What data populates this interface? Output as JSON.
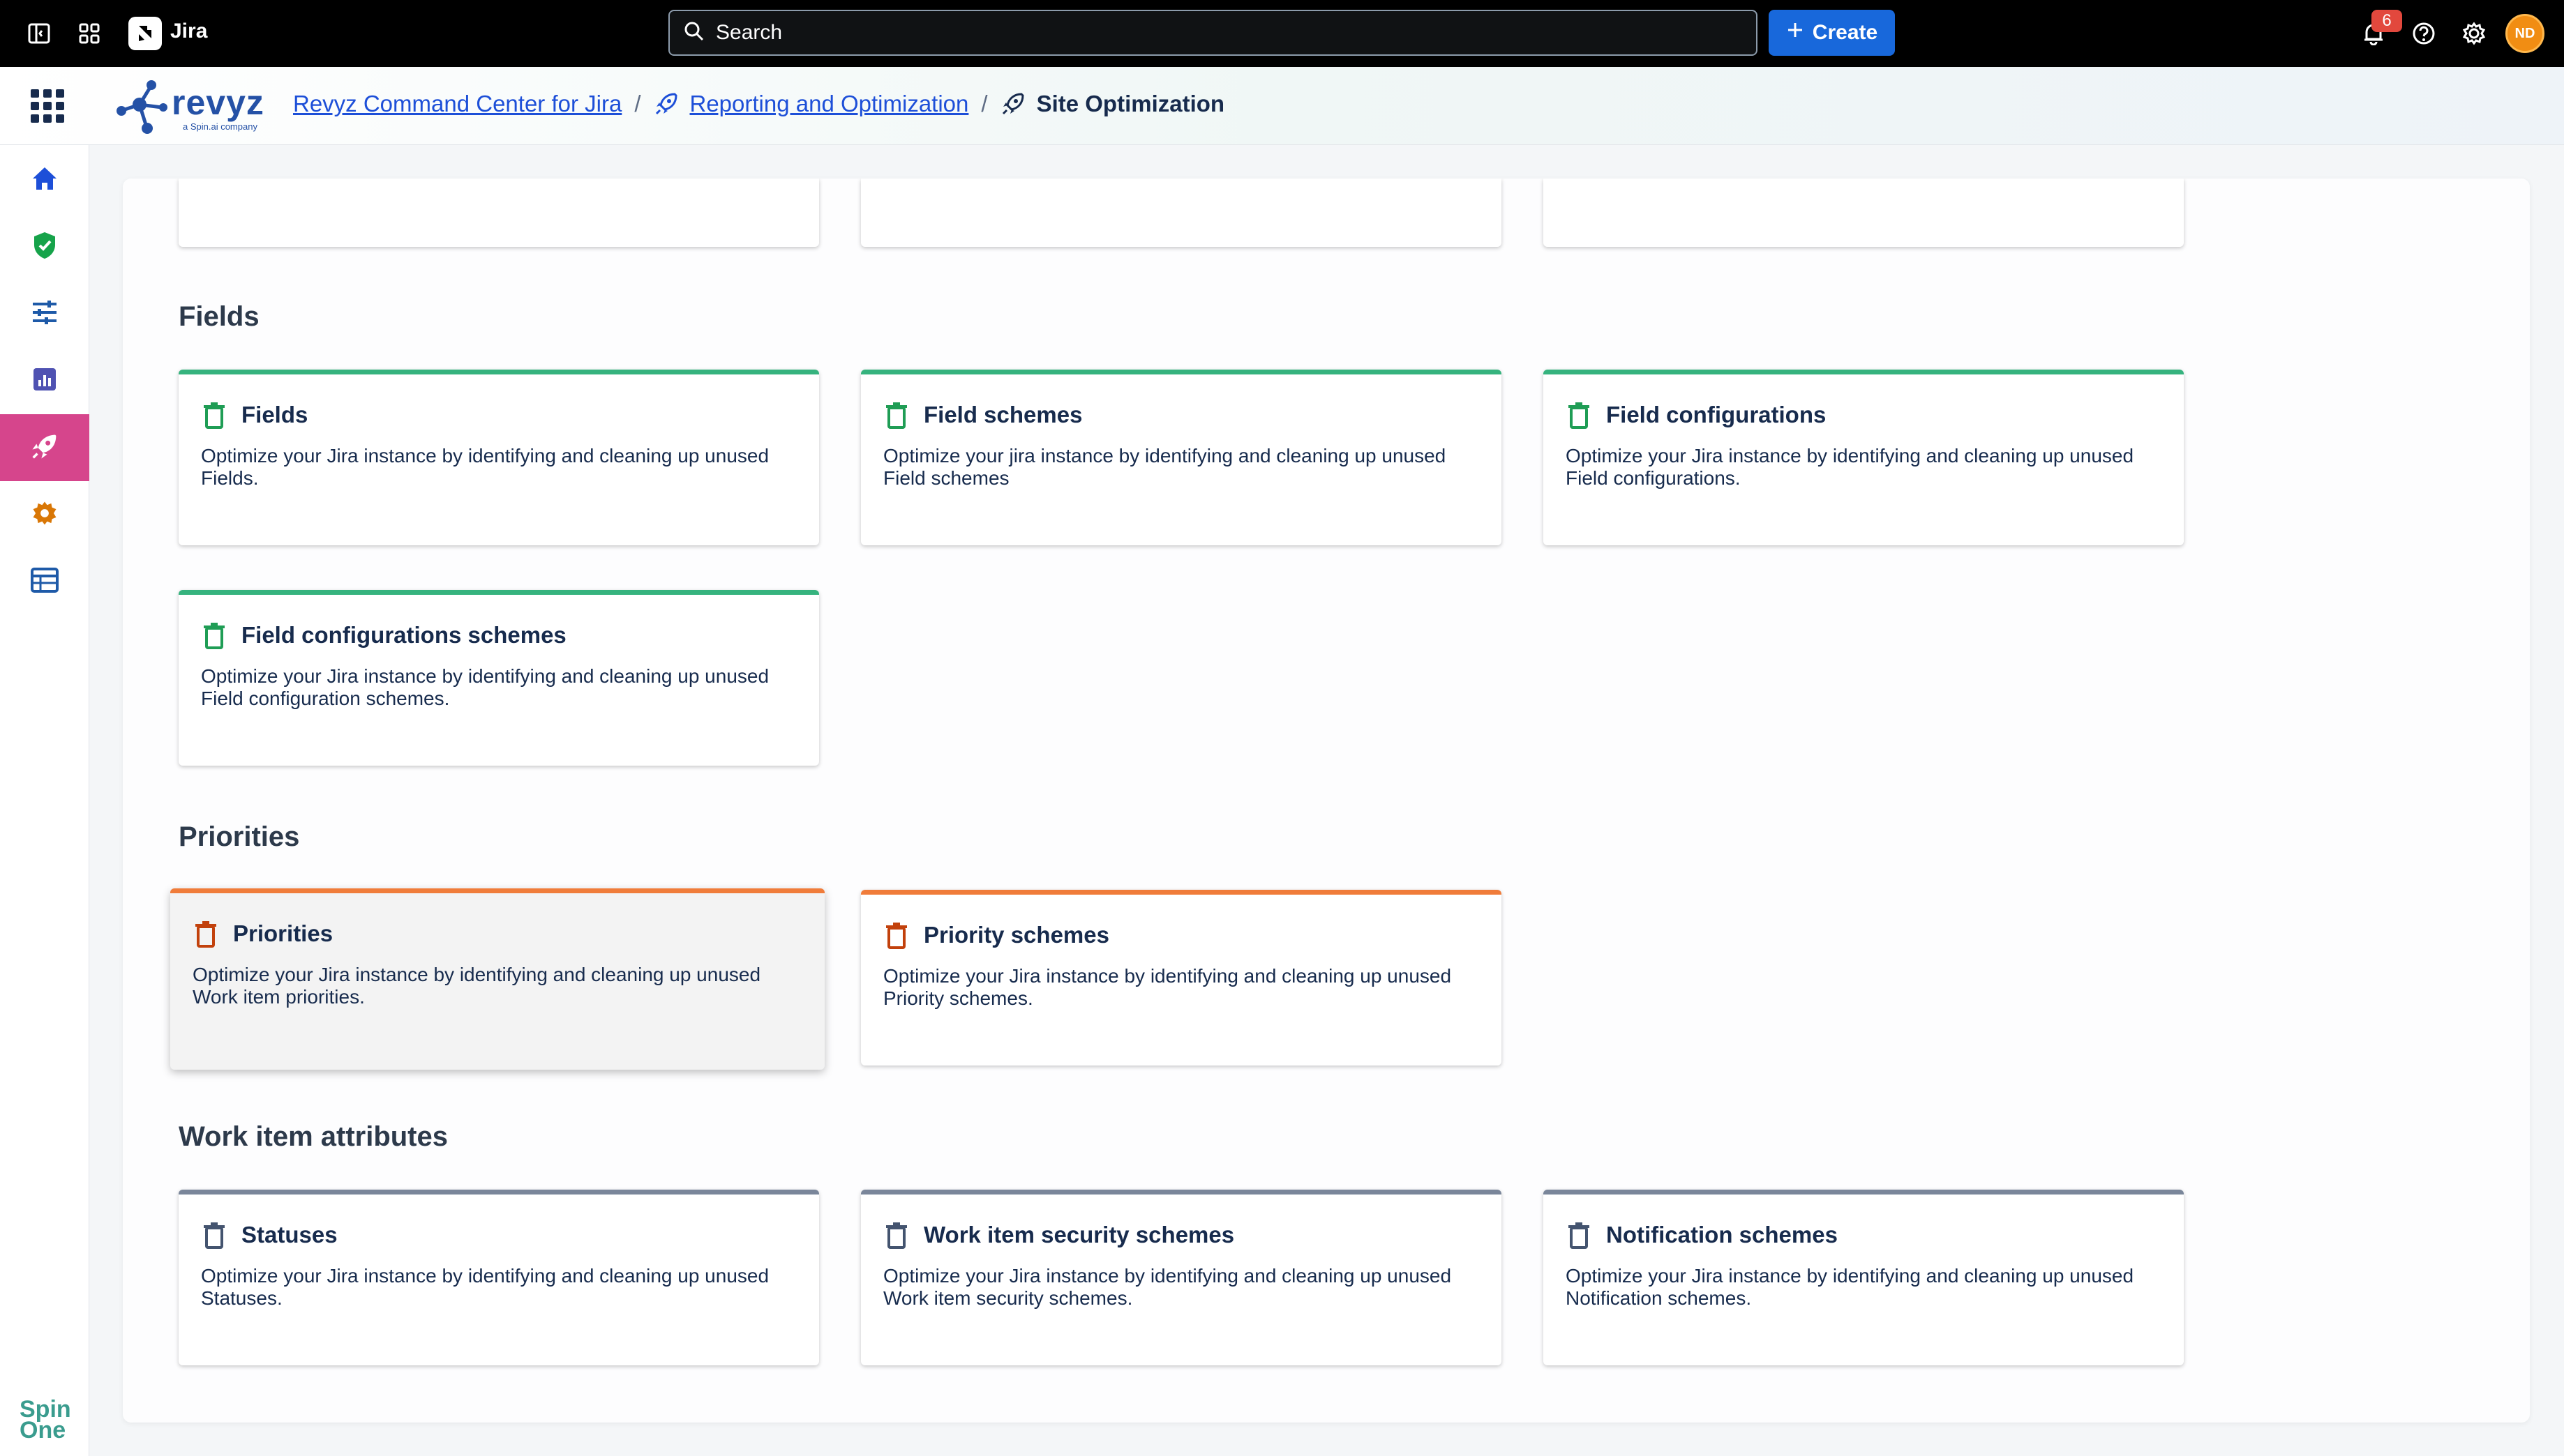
{
  "topbar": {
    "app_name": "Jira",
    "search_placeholder": "Search",
    "create_label": "Create",
    "notification_count": "6",
    "avatar_initials": "ND"
  },
  "breadcrumb": {
    "root": "Revyz Command Center for Jira",
    "section": "Reporting and Optimization",
    "current": "Site Optimization"
  },
  "brand": {
    "logo_word": "revyz",
    "logo_sub": "a Spin.ai company",
    "footer_logo_line1": "Spin",
    "footer_logo_line2": "One"
  },
  "colors": {
    "accent": "#1868db",
    "sidebar_active": "#d6458c",
    "fields_group": "#36b37e",
    "priorities_group": "#f07c3a",
    "work_item_group": "#7a869a"
  },
  "sections": {
    "fields": {
      "title": "Fields",
      "cards": [
        {
          "title": "Fields",
          "desc": "Optimize your Jira instance by identifying and cleaning up unused Fields."
        },
        {
          "title": "Field schemes",
          "desc": "Optimize your jira instance by identifying and cleaning up unused Field schemes"
        },
        {
          "title": "Field configurations",
          "desc": "Optimize your Jira instance by identifying and cleaning up unused Field configurations."
        },
        {
          "title": "Field configurations schemes",
          "desc": "Optimize your Jira instance by identifying and cleaning up unused Field configuration schemes."
        }
      ]
    },
    "priorities": {
      "title": "Priorities",
      "cards": [
        {
          "title": "Priorities",
          "desc": "Optimize your Jira instance by identifying and cleaning up unused Work item priorities."
        },
        {
          "title": "Priority schemes",
          "desc": "Optimize your Jira instance by identifying and cleaning up unused Priority schemes."
        }
      ]
    },
    "work_item": {
      "title": "Work item attributes",
      "cards": [
        {
          "title": "Statuses",
          "desc": "Optimize your Jira instance by identifying and cleaning up unused Statuses."
        },
        {
          "title": "Work item security schemes",
          "desc": "Optimize your Jira instance by identifying and cleaning up unused Work item security schemes."
        },
        {
          "title": "Notification schemes",
          "desc": "Optimize your Jira instance by identifying and cleaning up unused Notification schemes."
        }
      ]
    }
  },
  "sidebar": {
    "items": [
      "home-icon",
      "shield-check-icon",
      "sliders-icon",
      "bar-chart-icon",
      "rocket-icon",
      "gear-icon",
      "table-icon"
    ],
    "active_index": 4
  }
}
